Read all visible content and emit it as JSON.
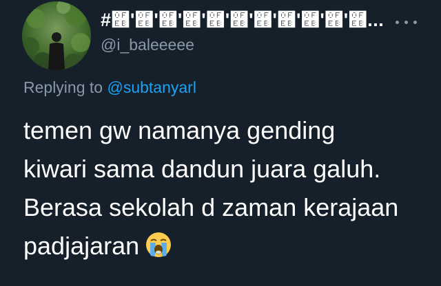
{
  "tweet": {
    "display_name": "#࿫'࿫'࿫'࿫'࿫'࿫'࿫'࿫'࿫'࿫'࿫...",
    "handle": "@i_baleeeee",
    "more_icon": "more-horizontal-icon",
    "reply_prefix": "Replying to",
    "reply_handle": "@subtanyarl",
    "text_lines": [
      "temen gw namanya gending",
      "kiwari sama dandun juara galuh.",
      "Berasa sekolah d zaman kerajaan",
      "padjajaran"
    ],
    "emoji": "loudly-crying-face-icon"
  },
  "colors": {
    "background": "#15202b",
    "secondary_text": "#8899a6",
    "link": "#1da1f2"
  }
}
